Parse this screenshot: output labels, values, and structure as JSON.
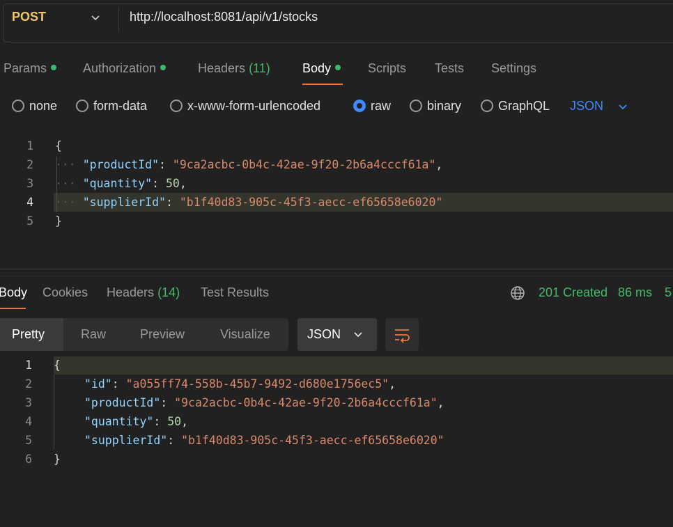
{
  "request": {
    "method": "POST",
    "url": "http://localhost:8081/api/v1/stocks"
  },
  "request_tabs": {
    "params": "Params",
    "authorization": "Authorization",
    "headers": "Headers",
    "headers_count": "(11)",
    "body": "Body",
    "scripts": "Scripts",
    "tests": "Tests",
    "settings": "Settings"
  },
  "body_types": {
    "none": "none",
    "form_data": "form-data",
    "urlencoded": "x-www-form-urlencoded",
    "raw": "raw",
    "binary": "binary",
    "graphql": "GraphQL",
    "selected": "raw",
    "language": "JSON"
  },
  "request_body": {
    "line_numbers": [
      "1",
      "2",
      "3",
      "4",
      "5"
    ],
    "open_brace": "{",
    "close_brace": "}",
    "productId_key": "\"productId\"",
    "productId_value": "\"9ca2acbc-0b4c-42ae-9f20-2b6a4cccf61a\"",
    "quantity_key": "\"quantity\"",
    "quantity_value": "50",
    "supplierId_key": "\"supplierId\"",
    "supplierId_value": "\"b1f40d83-905c-45f3-aecc-ef65658e6020\""
  },
  "response_tabs": {
    "body": "Body",
    "cookies": "Cookies",
    "headers": "Headers",
    "headers_count": "(14)",
    "test_results": "Test Results"
  },
  "response_status": {
    "status": "201 Created",
    "time": "86 ms",
    "size": "5"
  },
  "view_modes": {
    "pretty": "Pretty",
    "raw": "Raw",
    "preview": "Preview",
    "visualize": "Visualize",
    "format": "JSON"
  },
  "response_body": {
    "line_numbers": [
      "1",
      "2",
      "3",
      "4",
      "5",
      "6"
    ],
    "open_brace": "{",
    "close_brace": "}",
    "id_key": "\"id\"",
    "id_value": "\"a055ff74-558b-45b7-9492-d680e1756ec5\"",
    "productId_key": "\"productId\"",
    "productId_value": "\"9ca2acbc-0b4c-42ae-9f20-2b6a4cccf61a\"",
    "quantity_key": "\"quantity\"",
    "quantity_value": "50",
    "supplierId_key": "\"supplierId\"",
    "supplierId_value": "\"b1f40d83-905c-45f3-aecc-ef65658e6020\""
  },
  "colors": {
    "accent_orange": "#e8794a",
    "success_green": "#47b86b",
    "method_yellow": "#f1c667",
    "link_blue": "#3d8bff"
  }
}
